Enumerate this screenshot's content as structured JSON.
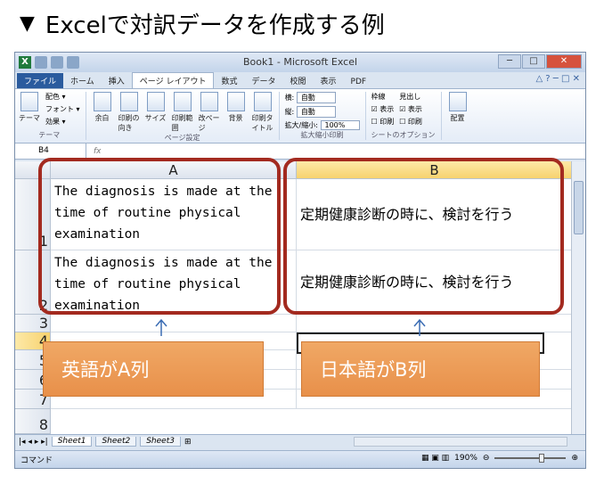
{
  "heading": {
    "symbol": "▼",
    "text": "Excelで対訳データを作成する例"
  },
  "window": {
    "title": "Book1 - Microsoft Excel",
    "min": "─",
    "max": "□",
    "close": "✕"
  },
  "tabs": [
    "ファイル",
    "ホーム",
    "挿入",
    "ページ レイアウト",
    "数式",
    "データ",
    "校閲",
    "表示",
    "PDF"
  ],
  "tabs_right": "△ ? ─ □ ✕",
  "ribbon": {
    "theme_group": {
      "label": "テーマ",
      "buttons": [
        "テーマ"
      ],
      "list": [
        "配色 ▾",
        "フォント ▾",
        "効果 ▾"
      ]
    },
    "page_group": {
      "label": "ページ設定",
      "buttons": [
        "余白",
        "印刷の向き",
        "サイズ",
        "印刷範囲",
        "改ページ",
        "背景",
        "印刷タイトル"
      ]
    },
    "scale_group": {
      "label": "拡大縮小印刷",
      "rows": [
        {
          "name": "横:",
          "value": "自動"
        },
        {
          "name": "縦:",
          "value": "自動"
        },
        {
          "name": "拡大/縮小:",
          "value": "100%"
        }
      ]
    },
    "sheet_group": {
      "label": "シートのオプション",
      "col1": [
        "枠線",
        "☑ 表示",
        "☐ 印刷"
      ],
      "col2": [
        "見出し",
        "☑ 表示",
        "☐ 印刷"
      ]
    },
    "arrange_group": {
      "buttons": [
        "配置"
      ]
    }
  },
  "formula_bar": {
    "name_box": "B4",
    "fx": "fx"
  },
  "columns": [
    "A",
    "B"
  ],
  "rows": [
    "1",
    "2",
    "3",
    "4",
    "5",
    "6",
    "7",
    "8"
  ],
  "cells": {
    "a1": "The diagnosis is made at the time of routine physical examination",
    "b1": "定期健康診断の時に、検討を行う",
    "a2": "The diagnosis is made at the time of routine physical examination",
    "b2": "定期健康診断の時に、検討を行う"
  },
  "sheet_tabs": [
    "Sheet1",
    "Sheet2",
    "Sheet3"
  ],
  "status": {
    "mode": "コマンド",
    "zoom": "190%"
  },
  "labels": {
    "english": "英語がA列",
    "japanese": "日本語がB列"
  },
  "colors": {
    "callout": "#a32a1f",
    "label_bg": "#e8904a",
    "selected_header": "#f7d26e"
  }
}
